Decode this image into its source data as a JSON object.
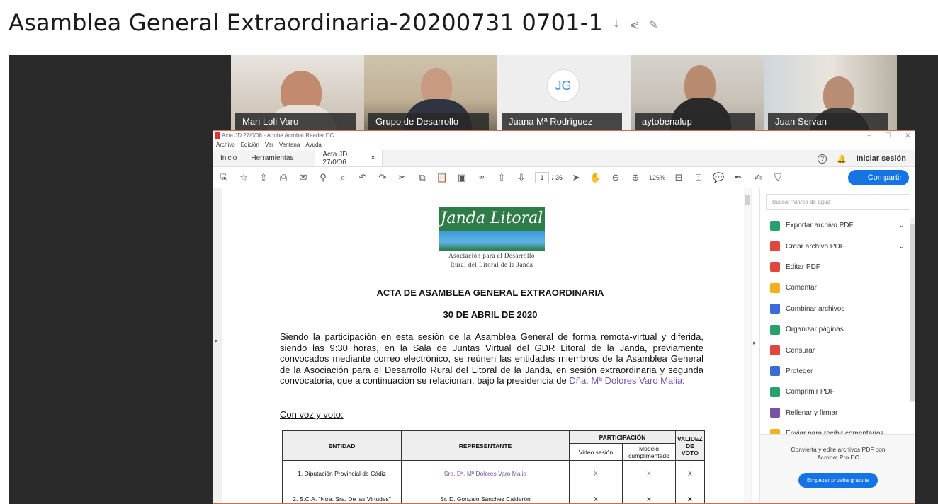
{
  "header": {
    "title": "Asamblea General Extraordinaria-20200731 0701-1",
    "icons": [
      "download-icon",
      "share-icon",
      "edit-icon"
    ]
  },
  "participants": [
    {
      "name": "Mari Loli Varo"
    },
    {
      "name": "Grupo de Desarrollo"
    },
    {
      "name": "Juana Mª Rodríguez",
      "initials": "JG"
    },
    {
      "name": "aytobenalup"
    },
    {
      "name": "Juan Servan"
    }
  ],
  "acrobat": {
    "window_title": "Acta JD 27/0/06 - Adobe Acrobat Reader DC",
    "menu": [
      "Archivo",
      "Edición",
      "Ver",
      "Ventana",
      "Ayuda"
    ],
    "tabs": {
      "home": "Inicio",
      "tools": "Herramientas",
      "doc": "Acta JD 27/0/06",
      "close": "×"
    },
    "signin": "Iniciar sesión",
    "page_current": "1",
    "page_total": "/ 36",
    "zoom": "126%",
    "share_label": "Compartir",
    "search_placeholder": "Buscar 'Marca de agua'",
    "tools": [
      {
        "label": "Exportar archivo PDF",
        "color": "#28a06a",
        "chevron": "⌄"
      },
      {
        "label": "Crear archivo PDF",
        "color": "#e0473c",
        "chevron": "⌄"
      },
      {
        "label": "Editar PDF",
        "color": "#e0473c"
      },
      {
        "label": "Comentar",
        "color": "#f3b01d"
      },
      {
        "label": "Combinar archivos",
        "color": "#3b6bd8"
      },
      {
        "label": "Organizar páginas",
        "color": "#28a06a"
      },
      {
        "label": "Censurar",
        "color": "#e0473c"
      },
      {
        "label": "Proteger",
        "color": "#3b6bd8"
      },
      {
        "label": "Comprimir PDF",
        "color": "#28a06a"
      },
      {
        "label": "Rellenar y firmar",
        "color": "#7a52a3"
      },
      {
        "label": "Enviar para recibir comentarios",
        "color": "#f3b01d"
      }
    ],
    "promo_text": "Convierta y edite archivos PDF con Acrobat Pro DC",
    "promo_button": "Empezar prueba gratuita"
  },
  "document": {
    "logo_name": "Janda Litoral",
    "logo_sub1": "Asociación para el Desarrollo",
    "logo_sub2": "Rural del Litoral de la Janda",
    "heading": "ACTA DE ASAMBLEA GENERAL EXTRAORDINARIA",
    "date": "30 DE ABRIL DE 2020",
    "para_text": "Siendo la participación en esta sesión de la Asamblea General de forma remota-virtual y diferida, siendo las 9:30 horas, en la Sala de Juntas Virtual del GDR Litoral de la Janda, previamente convocados mediante correo electrónico, se reúnen las entidades miembros de la Asamblea General de la Asociación para el Desarrollo Rural del Litoral de la Janda, en sesión extraordinaria y segunda convocatoria, que a continuación se relacionan, bajo la presidencia de ",
    "para_highlight": "Dña. Mª Dolores Varo Malia",
    "para_end": ":",
    "subheading": "Con voz y voto:",
    "table": {
      "h_entidad": "ENTIDAD",
      "h_representante": "REPRESENTANTE",
      "h_participacion": "PARTICIPACIÓN",
      "h_validez": "VALIDEZ DE VOTO",
      "h_video": "Video sesión",
      "h_modelo": "Modelo cumplimentado",
      "rows": [
        {
          "entidad": "1. Diputación Provincial de Cádiz",
          "rep": "Sra. Dª. Mª Dolores Varo Malia",
          "video": "X",
          "modelo": "X",
          "validez": "X"
        },
        {
          "entidad": "2. S.C.A. \"Ntra. Sra. De las Virtudes\"",
          "rep": "Sr. D. Gonzalo Sánchez Calderón",
          "video": "X",
          "modelo": "X",
          "validez": "X"
        }
      ]
    }
  }
}
